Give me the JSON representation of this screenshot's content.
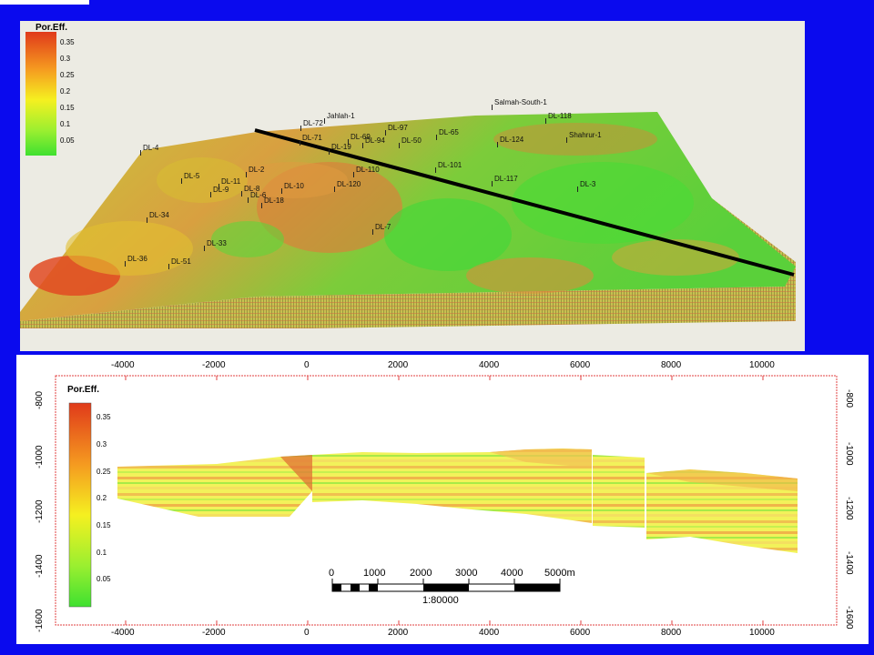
{
  "map3d": {
    "legend": {
      "title": "Por.Eff.",
      "ticks": [
        "0.35",
        "0.3",
        "0.25",
        "0.2",
        "0.15",
        "0.1",
        "0.05"
      ]
    },
    "wells": [
      {
        "name": "Jahlah-1"
      },
      {
        "name": "Salmah-South-1"
      },
      {
        "name": "DL-118"
      },
      {
        "name": "Shahrur-1"
      },
      {
        "name": "DL-124"
      },
      {
        "name": "DL-4"
      },
      {
        "name": "DL-5"
      },
      {
        "name": "DL-11"
      },
      {
        "name": "DL-9"
      },
      {
        "name": "DL-8"
      },
      {
        "name": "DL-6"
      },
      {
        "name": "DL-10"
      },
      {
        "name": "DL-34"
      },
      {
        "name": "DL-33"
      },
      {
        "name": "DL-36"
      },
      {
        "name": "DL-51"
      },
      {
        "name": "DL-7"
      },
      {
        "name": "DL-120"
      },
      {
        "name": "DL-110"
      },
      {
        "name": "DL-101"
      },
      {
        "name": "DL-117"
      },
      {
        "name": "DL-3"
      },
      {
        "name": "DL-97"
      },
      {
        "name": "DL-65"
      },
      {
        "name": "DL-94"
      },
      {
        "name": "DL-50"
      },
      {
        "name": "DL-71"
      },
      {
        "name": "DL-72"
      },
      {
        "name": "DL-69"
      },
      {
        "name": "DL-19"
      },
      {
        "name": "DL-2"
      },
      {
        "name": "DL-18"
      }
    ]
  },
  "section": {
    "legend": {
      "title": "Por.Eff.",
      "ticks": [
        "0.35",
        "0.3",
        "0.25",
        "0.2",
        "0.15",
        "0.1",
        "0.05"
      ]
    },
    "x_ticks": [
      "-4000",
      "-2000",
      "0",
      "2000",
      "4000",
      "6000",
      "8000",
      "10000"
    ],
    "y_ticks": [
      "-800",
      "-1000",
      "-1200",
      "-1400",
      "-1600"
    ],
    "scalebar": {
      "labels": [
        "0",
        "1000",
        "2000",
        "3000",
        "4000",
        "5000m"
      ],
      "scale": "1:80000"
    }
  },
  "colors": {
    "background": "#0a0aee",
    "porosity_high": "#e03a1a",
    "porosity_mid": "#f0e020",
    "porosity_low": "#40e030",
    "section_line": "#000000",
    "frame": "#e04040"
  }
}
